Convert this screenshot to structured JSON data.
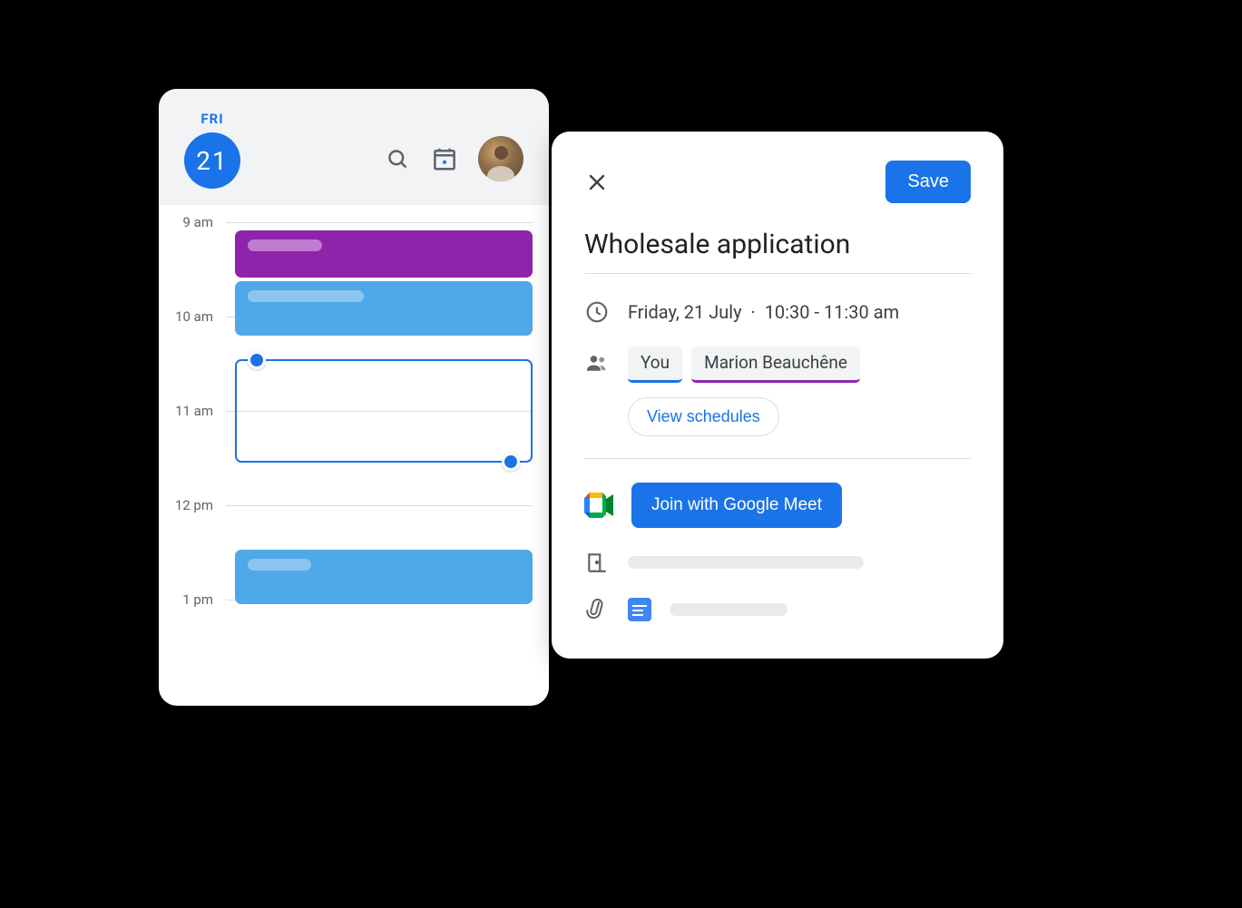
{
  "calendar": {
    "day_label": "FRI",
    "date_number": "21",
    "time_slots": [
      "9 am",
      "10 am",
      "11 am",
      "12 pm",
      "1 pm"
    ]
  },
  "event_detail": {
    "save_label": "Save",
    "title": "Wholesale application",
    "date_text": "Friday, 21 July",
    "time_text": "10:30 - 11:30 am",
    "separator": "·",
    "attendees": {
      "you_label": "You",
      "guest_name": "Marion Beauchêne"
    },
    "view_schedules_label": "View schedules",
    "meet_button_label": "Join with Google Meet"
  },
  "colors": {
    "primary": "#1a73e8",
    "purple": "#8e24aa",
    "light_blue": "#4fa9e8"
  }
}
